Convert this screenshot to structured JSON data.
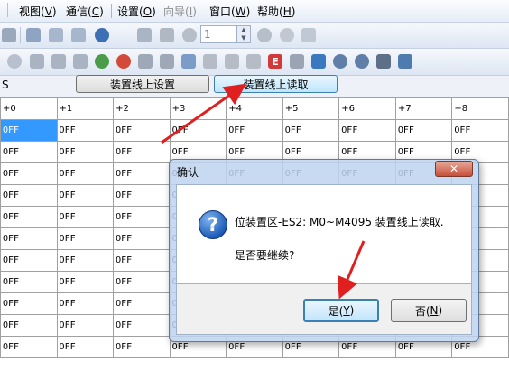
{
  "menubar": {
    "items": [
      {
        "label": "视图(V)",
        "enabled": true
      },
      {
        "label": "通信(C)",
        "enabled": true
      },
      {
        "label": "设置(O)",
        "enabled": true
      },
      {
        "label": "向导(I)",
        "enabled": false
      },
      {
        "label": "窗口(W)",
        "enabled": true
      },
      {
        "label": "帮助(H)",
        "enabled": true
      }
    ]
  },
  "toolbar": {
    "step_value": "1"
  },
  "buttonrow": {
    "left_label": "S",
    "setup_online_label": "装置线上设置",
    "read_online_label": "装置线上读取"
  },
  "grid": {
    "headers": [
      "+0",
      "+1",
      "+2",
      "+3",
      "+4",
      "+5",
      "+6",
      "+7",
      "+8"
    ],
    "cell_value": "OFF",
    "row_count": 11
  },
  "dialog": {
    "title": "确认",
    "close_symbol": "✕",
    "icon_symbol": "?",
    "message_line1": "位装置区-ES2: M0~M4095 装置线上读取.",
    "message_line2": "是否要继续?",
    "yes_label": "是(Y)",
    "yes_hotkey": "Y",
    "no_label": "否(N)",
    "no_hotkey": "N"
  },
  "colors": {
    "selected_cell": "#3399ff",
    "annotation_arrow": "#e02020",
    "dialog_frame": "#bed4ee"
  }
}
